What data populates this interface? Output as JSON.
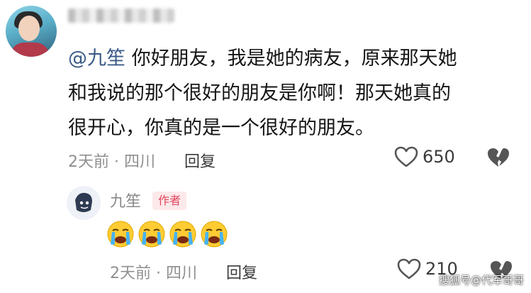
{
  "comment": {
    "mention": "@九笙",
    "line1": "你好朋友，我是她的病友，原来那天她",
    "line2": "和我说的那个很好的朋友是你啊！那天她真的",
    "line3": "很开心，你真的是一个很好的朋友。",
    "time_location": "2天前 · 四川",
    "reply_label": "回复",
    "like_count": "650"
  },
  "reply": {
    "author_name": "九笙",
    "author_badge": "作者",
    "emojis": [
      "crying-face",
      "crying-face",
      "crying-face",
      "crying-face"
    ],
    "time_location": "2天前 · 四川",
    "reply_label": "回复",
    "like_count": "210"
  },
  "watermark": "搜狐号@代军哥哥",
  "colors": {
    "mention": "#3a5a86",
    "badge_bg": "#fde8ea",
    "badge_text": "#e0475e",
    "meta": "#8f8f8f"
  }
}
